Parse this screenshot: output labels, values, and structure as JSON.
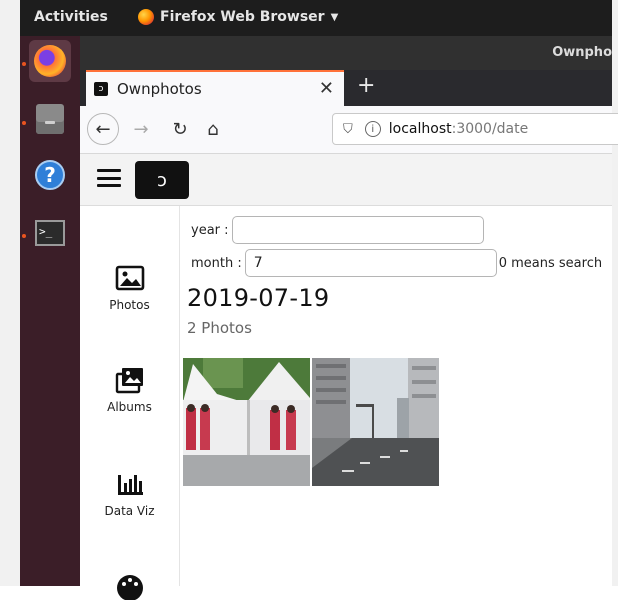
{
  "top_panel": {
    "activities": "Activities",
    "app_menu": "Firefox Web Browser"
  },
  "window": {
    "title": "Ownpho"
  },
  "tabs": [
    {
      "title": "Ownphotos"
    }
  ],
  "navbar": {
    "url_host": "localhost",
    "url_path": ":3000/date"
  },
  "sidebar": {
    "items": [
      {
        "label": "Photos"
      },
      {
        "label": "Albums"
      },
      {
        "label": "Data Viz"
      }
    ]
  },
  "search": {
    "year_label": "year :",
    "year_value": "",
    "month_label": "month :",
    "month_value": "7",
    "month_hint": "0 means search"
  },
  "results": {
    "date": "2019-07-19",
    "count": "2 Photos"
  },
  "icons": {
    "dock": [
      "firefox-icon",
      "files-icon",
      "help-icon",
      "terminal-icon"
    ],
    "sidebar": [
      "photo-icon",
      "albums-icon",
      "bar-chart-icon",
      "palette-icon"
    ]
  },
  "colors": {
    "accent": "#e95420",
    "dock_bg": "#3b1e28",
    "tab_highlight": "#ff7139"
  }
}
